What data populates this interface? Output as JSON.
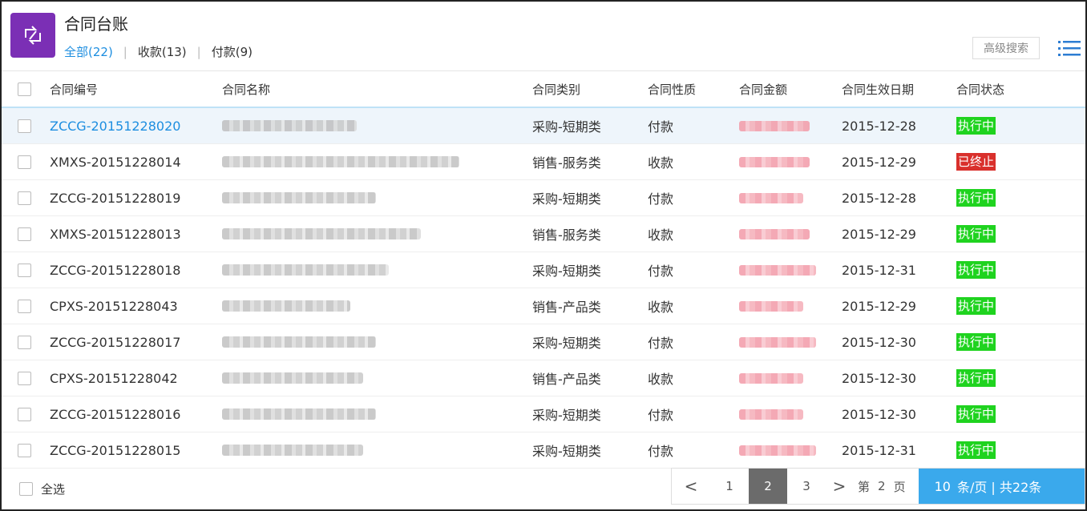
{
  "header": {
    "title": "合同台账",
    "filters": [
      {
        "label": "全部(22)",
        "active": true
      },
      {
        "label": "收款(13)",
        "active": false
      },
      {
        "label": "付款(9)",
        "active": false
      }
    ],
    "advanced_search": "高级搜索",
    "accent": "#1d8ee0",
    "logo_color": "#7b2fb5"
  },
  "table": {
    "columns": [
      "合同编号",
      "合同名称",
      "合同类别",
      "合同性质",
      "合同金额",
      "合同生效日期",
      "合同状态"
    ],
    "rows": [
      {
        "code": "ZCCG-20151228020",
        "category": "采购-短期类",
        "nature": "付款",
        "date": "2015-12-28",
        "status": "执行中",
        "status_color": "green"
      },
      {
        "code": "XMXS-20151228014",
        "category": "销售-服务类",
        "nature": "收款",
        "date": "2015-12-29",
        "status": "已终止",
        "status_color": "red"
      },
      {
        "code": "ZCCG-20151228019",
        "category": "采购-短期类",
        "nature": "付款",
        "date": "2015-12-28",
        "status": "执行中",
        "status_color": "green"
      },
      {
        "code": "XMXS-20151228013",
        "category": "销售-服务类",
        "nature": "收款",
        "date": "2015-12-29",
        "status": "执行中",
        "status_color": "green"
      },
      {
        "code": "ZCCG-20151228018",
        "category": "采购-短期类",
        "nature": "付款",
        "date": "2015-12-31",
        "status": "执行中",
        "status_color": "green"
      },
      {
        "code": "CPXS-20151228043",
        "category": "销售-产品类",
        "nature": "收款",
        "date": "2015-12-29",
        "status": "执行中",
        "status_color": "green"
      },
      {
        "code": "ZCCG-20151228017",
        "category": "采购-短期类",
        "nature": "付款",
        "date": "2015-12-30",
        "status": "执行中",
        "status_color": "green"
      },
      {
        "code": "CPXS-20151228042",
        "category": "销售-产品类",
        "nature": "收款",
        "date": "2015-12-30",
        "status": "执行中",
        "status_color": "green"
      },
      {
        "code": "ZCCG-20151228016",
        "category": "采购-短期类",
        "nature": "付款",
        "date": "2015-12-30",
        "status": "执行中",
        "status_color": "green"
      },
      {
        "code": "ZCCG-20151228015",
        "category": "采购-短期类",
        "nature": "付款",
        "date": "2015-12-31",
        "status": "执行中",
        "status_color": "green"
      }
    ]
  },
  "footer": {
    "select_all": "全选",
    "pager": {
      "prev": "<",
      "pages": [
        "1",
        "2",
        "3"
      ],
      "current": "2",
      "next": ">",
      "goto_prefix": "第",
      "goto_value": "2",
      "goto_suffix": "页",
      "page_size": "10",
      "page_size_unit": "条/页 | 共22条"
    }
  }
}
